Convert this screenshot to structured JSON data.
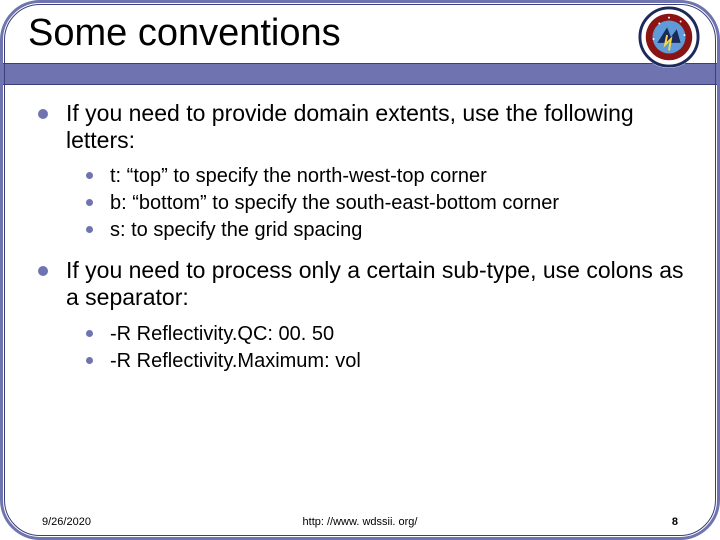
{
  "title": "Some conventions",
  "bullets": [
    {
      "text": "If you need to provide domain extents, use the following letters:",
      "sub": [
        "t: “top” to specify the north-west-top corner",
        "b: “bottom” to specify the south-east-bottom corner",
        "s: to specify the grid spacing"
      ]
    },
    {
      "text": "If you need to process only a certain sub-type, use colons as a separator:",
      "sub": [
        "-R Reflectivity.QC: 00. 50",
        "-R Reflectivity.Maximum: vol"
      ]
    }
  ],
  "footer": {
    "date": "9/26/2020",
    "url": "http: //www. wdssii. org/",
    "page": "8"
  },
  "logo_label": "NSSL logo"
}
